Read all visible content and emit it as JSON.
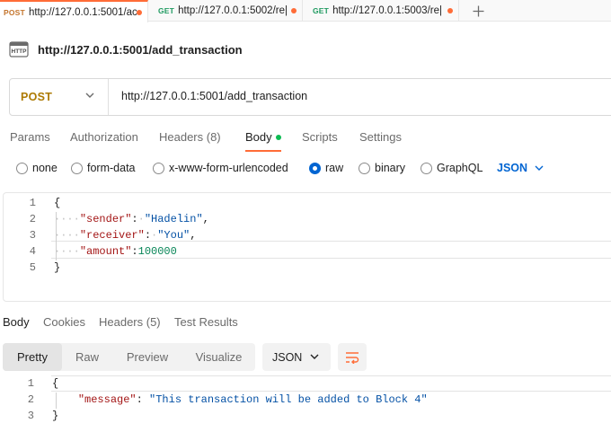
{
  "tabs": [
    {
      "method": "POST",
      "url": "http://127.0.0.1:5001/ac",
      "active": true
    },
    {
      "method": "GET",
      "url": "http://127.0.0.1:5002/re|",
      "active": false
    },
    {
      "method": "GET",
      "url": "http://127.0.0.1:5003/re|",
      "active": false
    }
  ],
  "new_tab_label": "+",
  "request": {
    "title": "http://127.0.0.1:5001/add_transaction",
    "method": "POST",
    "url": "http://127.0.0.1:5001/add_transaction"
  },
  "request_tabs": [
    "Params",
    "Authorization",
    "Headers (8)",
    "Body",
    "Scripts",
    "Settings"
  ],
  "body_types": [
    "none",
    "form-data",
    "x-www-form-urlencoded",
    "raw",
    "binary",
    "GraphQL"
  ],
  "body_type_selected": "raw",
  "body_format": "JSON",
  "request_body": {
    "line_numbers": [
      "1",
      "2",
      "3",
      "4",
      "5"
    ],
    "open": "{",
    "close": "}",
    "sender_key": "\"sender\"",
    "sender_value": "\"Hadelin\"",
    "receiver_key": "\"receiver\"",
    "receiver_value": "\"You\"",
    "amount_key": "\"amount\"",
    "amount_value": "100000"
  },
  "response_tabs": [
    "Body",
    "Cookies",
    "Headers (5)",
    "Test Results"
  ],
  "response_views": [
    "Pretty",
    "Raw",
    "Preview",
    "Visualize"
  ],
  "response_format": "JSON",
  "response_body": {
    "line_numbers": [
      "1",
      "2",
      "3"
    ],
    "open": "{",
    "close": "}",
    "message_key": "\"message\"",
    "message_value": "\"This transaction will be added to Block 4\""
  },
  "colors": {
    "accent": "#ff6c37",
    "post_method": "#ad7a03",
    "get_method": "#1f9a60",
    "link_blue": "#0265d2",
    "json_key": "#a31515",
    "json_string": "#0451a5",
    "json_number": "#098658"
  }
}
